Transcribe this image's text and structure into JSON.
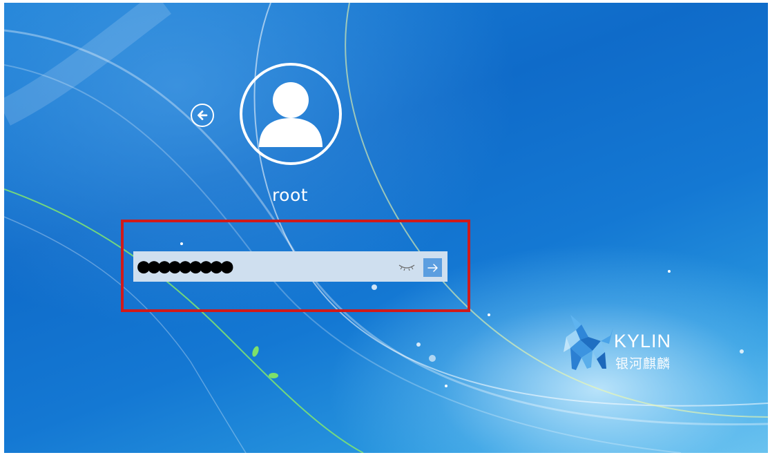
{
  "login": {
    "username": "root",
    "password_mask": "●●●●●●●●●"
  },
  "brand": {
    "name_en": "KYLIN",
    "name_cn": "银河麒麟"
  },
  "icons": {
    "back": "arrow-left-circle-icon",
    "avatar": "user-silhouette-icon",
    "toggle_visibility": "closed-eye-icon",
    "submit": "arrow-right-icon",
    "logo": "kylin-unicorn-logo-icon"
  },
  "colors": {
    "background": "#1478d3",
    "highlight_border": "#d01a1a",
    "password_field": "#cfdfef",
    "submit_button": "#5b9ee0",
    "text": "#ffffff"
  }
}
